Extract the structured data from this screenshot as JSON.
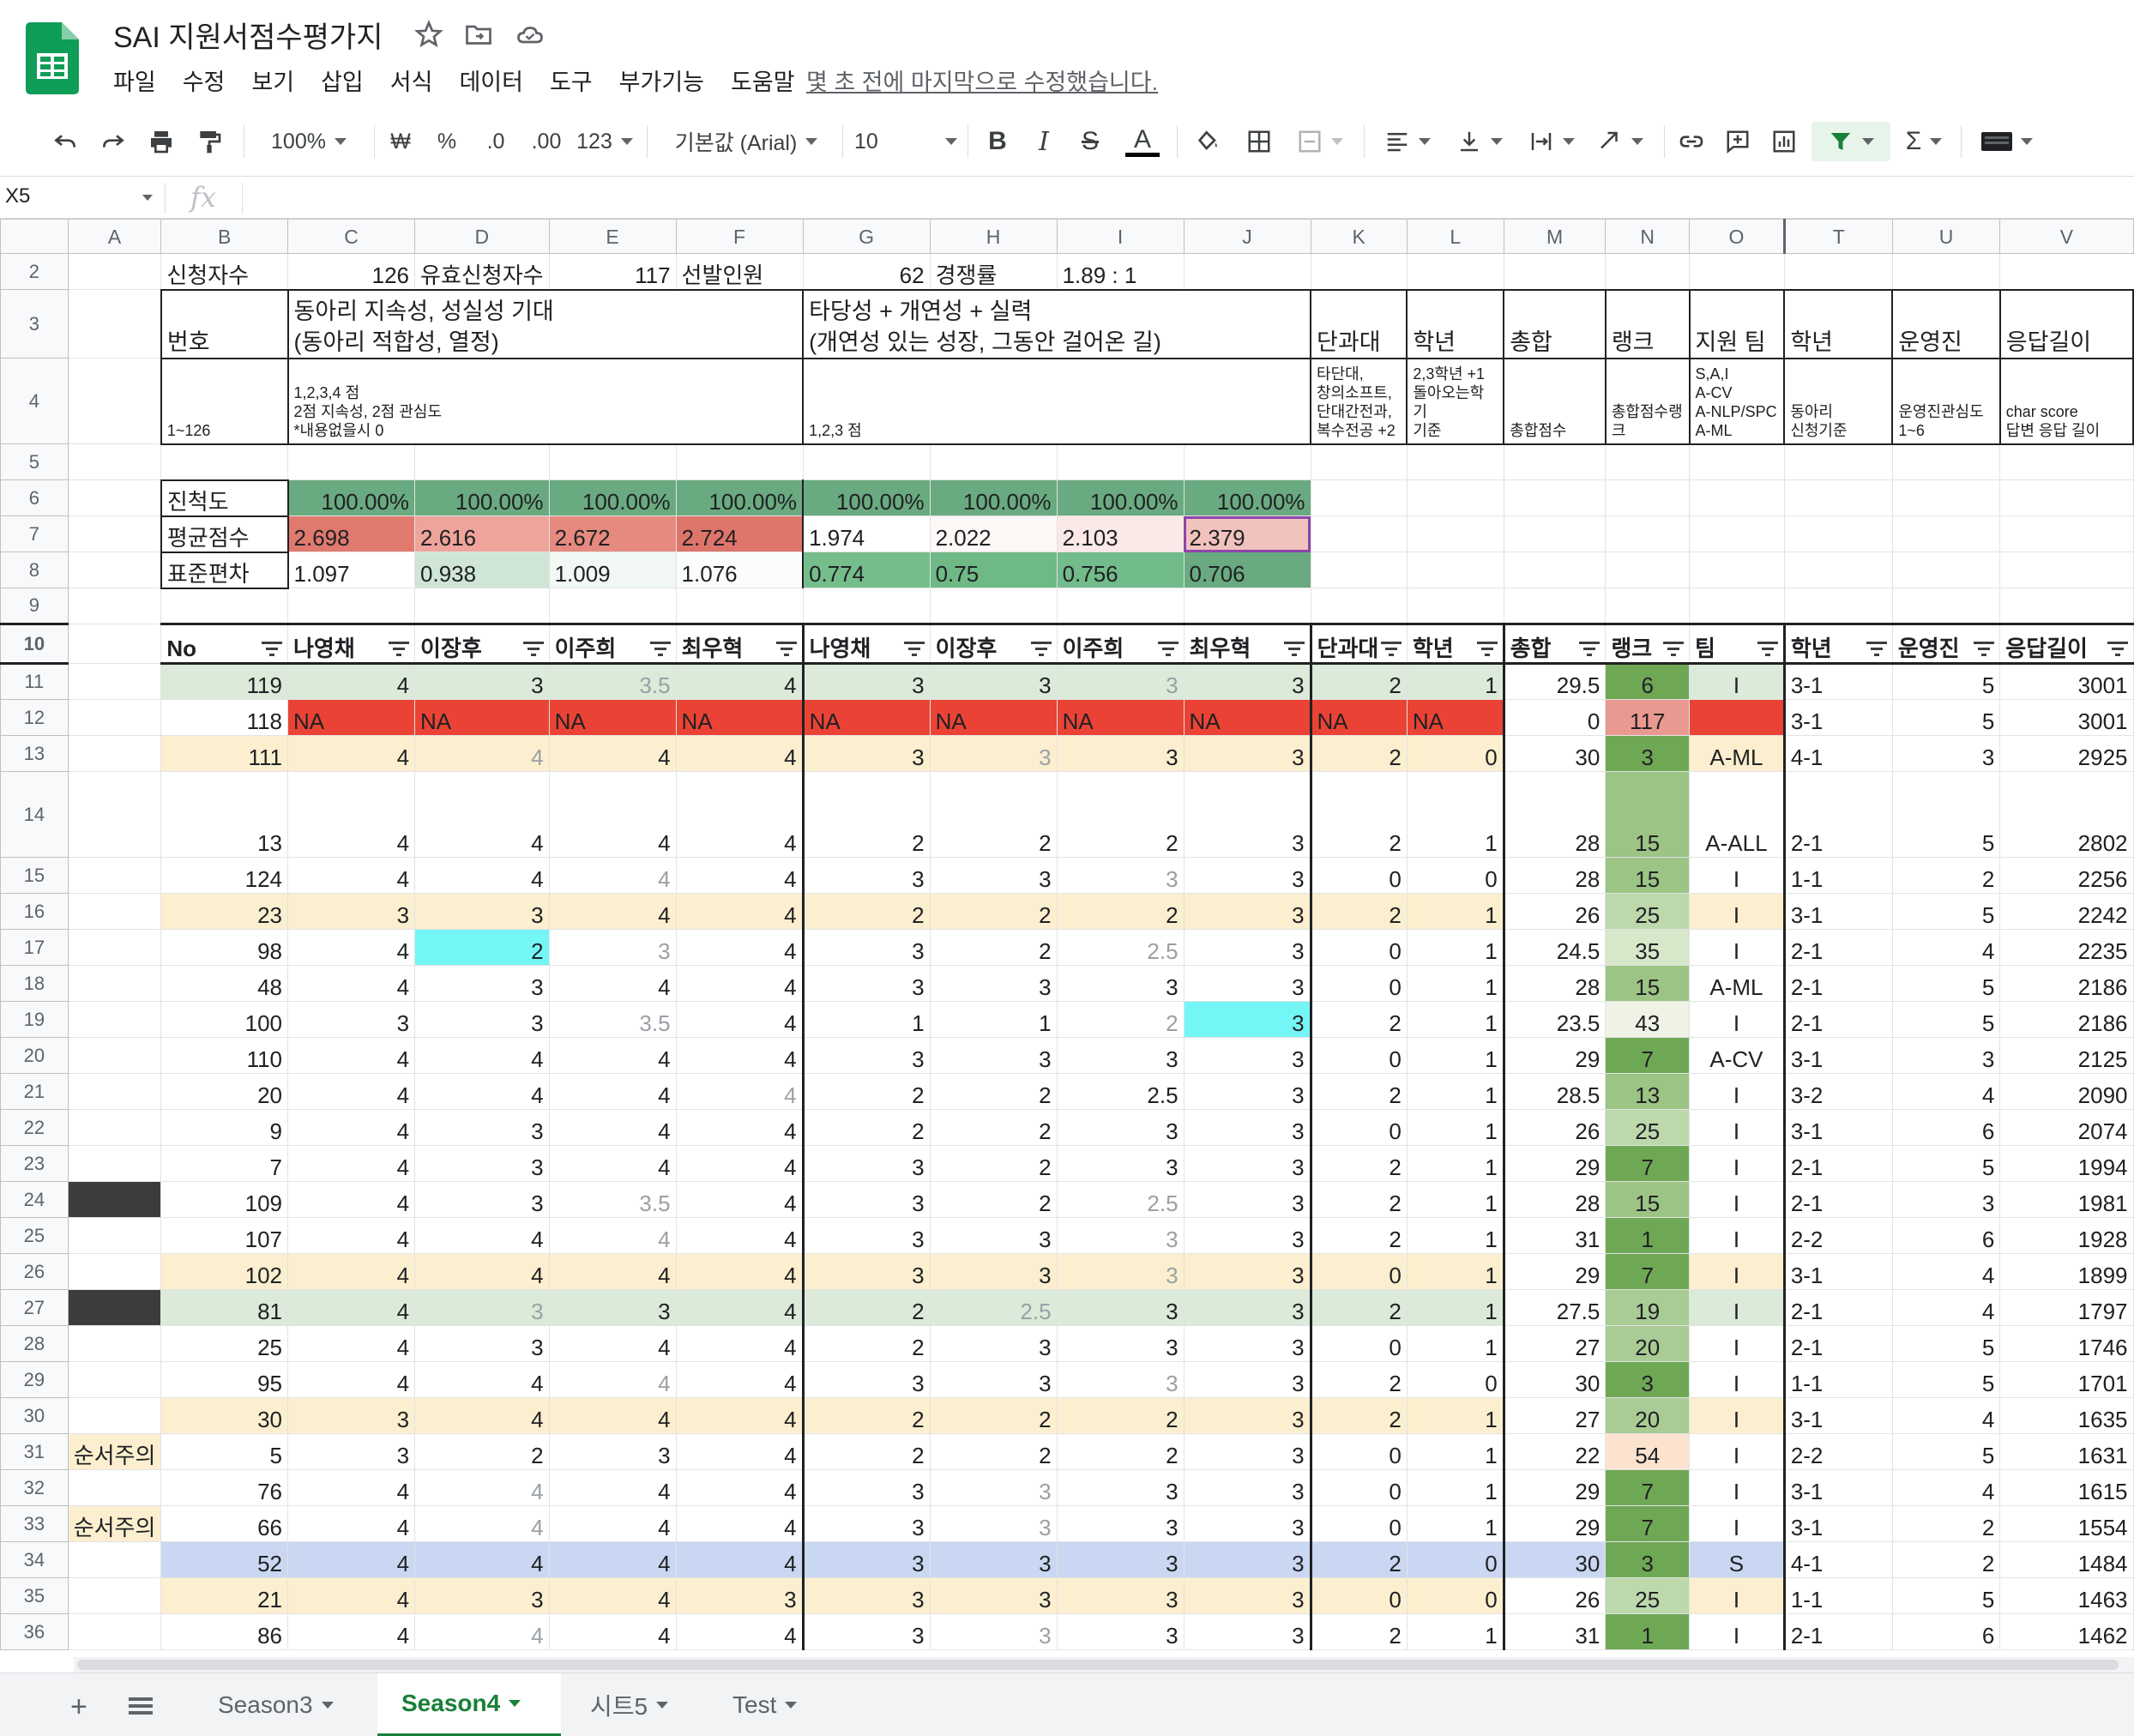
{
  "app": {
    "title": "SAI 지원서점수평가지",
    "last_edit": "몇 초 전에 마지막으로 수정했습니다.",
    "menu": [
      "파일",
      "수정",
      "보기",
      "삽입",
      "서식",
      "데이터",
      "도구",
      "부가기능",
      "도움말"
    ]
  },
  "toolbar": {
    "zoom": "100%",
    "currency": "₩",
    "percent": "%",
    "dec_less": ".0",
    "dec_more": ".00",
    "number_format": "123",
    "font": "기본값 (Arial)",
    "font_size": "10",
    "bold": "B",
    "italic": "I",
    "strike": "S",
    "text_color": "A",
    "sum": "Σ"
  },
  "formula_bar": {
    "cell_ref": "X5",
    "fx": "fx",
    "content": ""
  },
  "colors": {
    "brand_green": "#0f9d58",
    "progress_green": "#6aaa80",
    "avg_red": "#e07a6e",
    "na_red": "#ea4335",
    "cyan_highlight": "#74f6f7",
    "blue_row": "#c9d7f2",
    "yellow_row": "#fcefcf",
    "green_row": "#dbead9",
    "dark_green_rank": "#6ea855"
  },
  "columns": [
    "A",
    "B",
    "C",
    "D",
    "E",
    "F",
    "G",
    "H",
    "I",
    "J",
    "K",
    "L",
    "M",
    "N",
    "O",
    "T",
    "U",
    "V"
  ],
  "summary": {
    "row2": {
      "applicants_label": "신청자수",
      "applicants": "126",
      "valid_label": "유효신청자수",
      "valid": "117",
      "selected_label": "선발인원",
      "selected": "62",
      "ratio_label": "경쟁률",
      "ratio": "1.89 : 1"
    },
    "row3": {
      "no": "번호",
      "group1": "동아리 지속성, 성실성 기대\n(동아리 적합성, 열정)",
      "group2": "타당성 + 개연성 + 실력\n(개연성 있는 성장, 그동안 걸어온 길)",
      "k": "단과대",
      "l": "학년",
      "m": "총합",
      "n": "랭크",
      "o": "지원 팀",
      "t": "학년",
      "u": "운영진",
      "v": "응답길이"
    },
    "row4": {
      "b": "1~126",
      "c": "1,2,3,4 점\n2점 지속성, 2점 관심도\n*내용없을시 0",
      "g": "1,2,3 점",
      "k": "타단대,\n창의소프트,\n단대간전과,\n복수전공 +2",
      "l": "2,3학년 +1\n돌아오는학기\n기준",
      "m": "총합점수",
      "n": "총합점수랭크",
      "o": "S,A,I\nA-CV\nA-NLP/SPC\nA-ML",
      "t": "동아리\n신청기준",
      "u": "운영진관심도\n1~6",
      "v": "char score\n답변 응답 길이"
    },
    "progress_label": "진척도",
    "progress": [
      "100.00%",
      "100.00%",
      "100.00%",
      "100.00%",
      "100.00%",
      "100.00%",
      "100.00%",
      "100.00%"
    ],
    "avg_label": "평균점수",
    "avg": [
      "2.698",
      "2.616",
      "2.672",
      "2.724",
      "1.974",
      "2.022",
      "2.103",
      "2.379"
    ],
    "std_label": "표준편차",
    "std": [
      "1.097",
      "0.938",
      "1.009",
      "1.076",
      "0.774",
      "0.75",
      "0.756",
      "0.706"
    ]
  },
  "table_header": [
    "No",
    "나영채",
    "이장후",
    "이주희",
    "최우혁",
    "나영채",
    "이장후",
    "이주희",
    "최우혁",
    "단과대",
    "학년",
    "총합",
    "랭크",
    "팀",
    "학년",
    "운영진",
    "응답길이"
  ],
  "rows": [
    {
      "r": "11",
      "a": "",
      "v": [
        "119",
        "4",
        "3",
        "3.5",
        "4",
        "3",
        "3",
        "3",
        "3",
        "2",
        "1",
        "29.5",
        "6",
        "I",
        "3-1",
        "5",
        "3001"
      ]
    },
    {
      "r": "12",
      "a": "",
      "v": [
        "118",
        "NA",
        "NA",
        "NA",
        "NA",
        "NA",
        "NA",
        "NA",
        "NA",
        "NA",
        "NA",
        "0",
        "117",
        "",
        "3-1",
        "5",
        "3001"
      ]
    },
    {
      "r": "13",
      "a": "",
      "v": [
        "111",
        "4",
        "4",
        "4",
        "4",
        "3",
        "3",
        "3",
        "3",
        "2",
        "0",
        "30",
        "3",
        "A-ML",
        "4-1",
        "3",
        "2925"
      ]
    },
    {
      "r": "14",
      "a": "",
      "v": [
        "13",
        "4",
        "4",
        "4",
        "4",
        "2",
        "2",
        "2",
        "3",
        "2",
        "1",
        "28",
        "15",
        "A-ALL",
        "2-1",
        "5",
        "2802"
      ]
    },
    {
      "r": "15",
      "a": "",
      "v": [
        "124",
        "4",
        "4",
        "4",
        "4",
        "3",
        "3",
        "3",
        "3",
        "0",
        "0",
        "28",
        "15",
        "I",
        "1-1",
        "2",
        "2256"
      ]
    },
    {
      "r": "16",
      "a": "",
      "v": [
        "23",
        "3",
        "3",
        "4",
        "4",
        "2",
        "2",
        "2",
        "3",
        "2",
        "1",
        "26",
        "25",
        "I",
        "3-1",
        "5",
        "2242"
      ]
    },
    {
      "r": "17",
      "a": "",
      "v": [
        "98",
        "4",
        "2",
        "3",
        "4",
        "3",
        "2",
        "2.5",
        "3",
        "0",
        "1",
        "24.5",
        "35",
        "I",
        "2-1",
        "4",
        "2235"
      ]
    },
    {
      "r": "18",
      "a": "",
      "v": [
        "48",
        "4",
        "3",
        "4",
        "4",
        "3",
        "3",
        "3",
        "3",
        "0",
        "1",
        "28",
        "15",
        "A-ML",
        "2-1",
        "5",
        "2186"
      ]
    },
    {
      "r": "19",
      "a": "",
      "v": [
        "100",
        "3",
        "3",
        "3.5",
        "4",
        "1",
        "1",
        "2",
        "3",
        "2",
        "1",
        "23.5",
        "43",
        "I",
        "2-1",
        "5",
        "2186"
      ]
    },
    {
      "r": "20",
      "a": "",
      "v": [
        "110",
        "4",
        "4",
        "4",
        "4",
        "3",
        "3",
        "3",
        "3",
        "0",
        "1",
        "29",
        "7",
        "A-CV",
        "3-1",
        "3",
        "2125"
      ]
    },
    {
      "r": "21",
      "a": "",
      "v": [
        "20",
        "4",
        "4",
        "4",
        "4",
        "2",
        "2",
        "2.5",
        "3",
        "2",
        "1",
        "28.5",
        "13",
        "I",
        "3-2",
        "4",
        "2090"
      ]
    },
    {
      "r": "22",
      "a": "",
      "v": [
        "9",
        "4",
        "3",
        "4",
        "4",
        "2",
        "2",
        "3",
        "3",
        "0",
        "1",
        "26",
        "25",
        "I",
        "3-1",
        "6",
        "2074"
      ]
    },
    {
      "r": "23",
      "a": "",
      "v": [
        "7",
        "4",
        "3",
        "4",
        "4",
        "3",
        "2",
        "3",
        "3",
        "2",
        "1",
        "29",
        "7",
        "I",
        "2-1",
        "5",
        "1994"
      ]
    },
    {
      "r": "24",
      "a": "",
      "v": [
        "109",
        "4",
        "3",
        "3.5",
        "4",
        "3",
        "2",
        "2.5",
        "3",
        "2",
        "1",
        "28",
        "15",
        "I",
        "2-1",
        "3",
        "1981"
      ]
    },
    {
      "r": "25",
      "a": "",
      "v": [
        "107",
        "4",
        "4",
        "4",
        "4",
        "3",
        "3",
        "3",
        "3",
        "2",
        "1",
        "31",
        "1",
        "I",
        "2-2",
        "6",
        "1928"
      ]
    },
    {
      "r": "26",
      "a": "",
      "v": [
        "102",
        "4",
        "4",
        "4",
        "4",
        "3",
        "3",
        "3",
        "3",
        "0",
        "1",
        "29",
        "7",
        "I",
        "3-1",
        "4",
        "1899"
      ]
    },
    {
      "r": "27",
      "a": "",
      "v": [
        "81",
        "4",
        "3",
        "3",
        "4",
        "2",
        "2.5",
        "3",
        "3",
        "2",
        "1",
        "27.5",
        "19",
        "I",
        "2-1",
        "4",
        "1797"
      ]
    },
    {
      "r": "28",
      "a": "",
      "v": [
        "25",
        "4",
        "3",
        "4",
        "4",
        "2",
        "3",
        "3",
        "3",
        "0",
        "1",
        "27",
        "20",
        "I",
        "2-1",
        "5",
        "1746"
      ]
    },
    {
      "r": "29",
      "a": "",
      "v": [
        "95",
        "4",
        "4",
        "4",
        "4",
        "3",
        "3",
        "3",
        "3",
        "2",
        "0",
        "30",
        "3",
        "I",
        "1-1",
        "5",
        "1701"
      ]
    },
    {
      "r": "30",
      "a": "",
      "v": [
        "30",
        "3",
        "4",
        "4",
        "4",
        "2",
        "2",
        "2",
        "3",
        "2",
        "1",
        "27",
        "20",
        "I",
        "3-1",
        "4",
        "1635"
      ]
    },
    {
      "r": "31",
      "a": "순서주의",
      "v": [
        "5",
        "3",
        "2",
        "3",
        "4",
        "2",
        "2",
        "2",
        "3",
        "0",
        "1",
        "22",
        "54",
        "I",
        "2-2",
        "5",
        "1631"
      ]
    },
    {
      "r": "32",
      "a": "",
      "v": [
        "76",
        "4",
        "4",
        "4",
        "4",
        "3",
        "3",
        "3",
        "3",
        "0",
        "1",
        "29",
        "7",
        "I",
        "3-1",
        "4",
        "1615"
      ]
    },
    {
      "r": "33",
      "a": "순서주의",
      "v": [
        "66",
        "4",
        "4",
        "4",
        "4",
        "3",
        "3",
        "3",
        "3",
        "0",
        "1",
        "29",
        "7",
        "I",
        "3-1",
        "2",
        "1554"
      ]
    },
    {
      "r": "34",
      "a": "",
      "v": [
        "52",
        "4",
        "4",
        "4",
        "4",
        "3",
        "3",
        "3",
        "3",
        "2",
        "0",
        "30",
        "3",
        "S",
        "4-1",
        "2",
        "1484"
      ]
    },
    {
      "r": "35",
      "a": "",
      "v": [
        "21",
        "4",
        "3",
        "4",
        "3",
        "3",
        "3",
        "3",
        "3",
        "0",
        "0",
        "26",
        "25",
        "I",
        "1-1",
        "5",
        "1463"
      ]
    },
    {
      "r": "36",
      "a": "",
      "v": [
        "86",
        "4",
        "4",
        "4",
        "4",
        "3",
        "3",
        "3",
        "3",
        "2",
        "1",
        "31",
        "1",
        "I",
        "2-1",
        "6",
        "1462"
      ]
    }
  ],
  "row_styles": {
    "13": "yellow",
    "16": "yellow",
    "26": "yellow",
    "30": "yellow",
    "35": "yellow",
    "11": "green",
    "27": "green",
    "34": "blue",
    "12": "na"
  },
  "dark_a_rows": [
    "24",
    "27"
  ],
  "grey_cells": {
    "11": [
      3,
      7
    ],
    "13": [
      2,
      6
    ],
    "15": [
      3,
      7
    ],
    "17": [
      3,
      7
    ],
    "19": [
      3,
      7
    ],
    "21": [
      4
    ],
    "24": [
      3,
      7
    ],
    "25": [
      3,
      7
    ],
    "26": [
      7
    ],
    "27": [
      2,
      6
    ],
    "29": [
      3,
      7
    ],
    "32": [
      2,
      6
    ],
    "33": [
      2,
      6
    ],
    "36": [
      2,
      6
    ]
  },
  "cyan_cells": {
    "17": [
      2
    ],
    "19": [
      8
    ]
  },
  "sheets": [
    "Season3",
    "Season4",
    "시트5",
    "Test"
  ],
  "active_sheet": "Season4"
}
